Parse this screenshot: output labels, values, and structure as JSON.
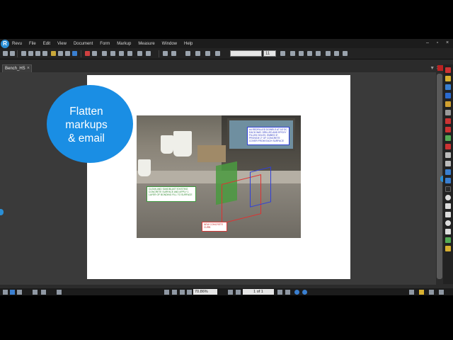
{
  "app": {
    "logo_letter": "R",
    "menu": [
      "Revu",
      "File",
      "Edit",
      "View",
      "Document",
      "Form",
      "Markup",
      "Measure",
      "Window",
      "Help"
    ]
  },
  "toolbar": {
    "font_size_value": "11"
  },
  "tabs": [
    {
      "label": "Bench_HS"
    }
  ],
  "overlay": {
    "line1": "Flatten",
    "line2": "markups",
    "line3": "& email"
  },
  "annotations": {
    "blue": "#4 REDRILLED DOWELS AT 16\"OC EACH WAY. DRILLED AND EPOXY FILLED HOLES, EMBED 6\". PROVIDE 2\" OF CONCRETE COVER FROM EACH SURFACE",
    "green": "CLEAN AND SANDBLAST EXISTING CONCRETE SURFACE AND APPLY 1 LAYER OF BONDING FILL TO SURFACE",
    "red": "NEW CONCRETE CURB"
  },
  "status": {
    "zoom": "70.86%",
    "page_indicator": "1 of 1"
  },
  "colors": {
    "accent": "#1a8ee4",
    "markup_blue": "#3040d8",
    "markup_green": "#3f9a3f",
    "markup_red": "#d83a3a"
  }
}
